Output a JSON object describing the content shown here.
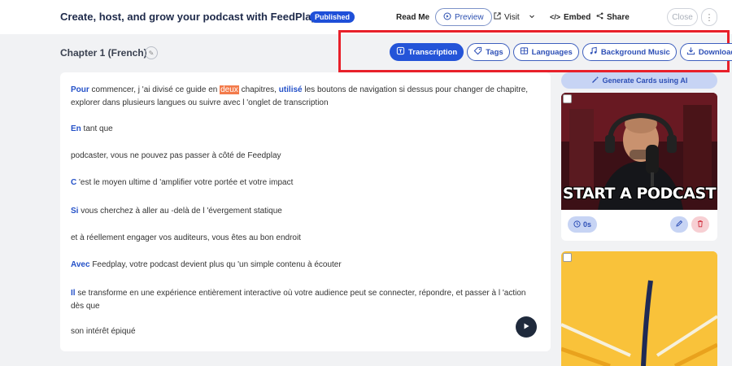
{
  "header": {
    "title": "Create, host, and grow your podcast with FeedPlay!",
    "status_badge": "Published",
    "read_me": "Read Me",
    "preview": "Preview",
    "visit": "Visit",
    "embed": "Embed",
    "share": "Share",
    "close": "Close"
  },
  "chapter": {
    "title": "Chapter 1 (French)"
  },
  "tabs": [
    {
      "label": "Transcription",
      "icon": "transcript-icon",
      "active": true
    },
    {
      "label": "Tags",
      "icon": "tag-icon",
      "active": false
    },
    {
      "label": "Languages",
      "icon": "languages-icon",
      "active": false
    },
    {
      "label": "Background Music",
      "icon": "music-icon",
      "active": false
    },
    {
      "label": "Download",
      "icon": "download-icon",
      "active": false
    }
  ],
  "transcript": {
    "l1": {
      "kw1": "Pour",
      "t1": " commencer, j 'ai divisé ce guide en ",
      "hl": "deux",
      "t2": " chapitres, ",
      "kw2": "utilisé",
      "t3": " les boutons de navigation si dessus pour changer de chapitre,"
    },
    "l1b": "explorer dans plusieurs langues ou suivre avec l 'onglet de transcription",
    "l2": {
      "kw": "En",
      "t": " tant que"
    },
    "l3": "podcaster, vous ne pouvez pas passer à côté de Feedplay",
    "l4": {
      "kw": "C",
      "t": " 'est le moyen ultime d 'amplifier votre portée et votre impact"
    },
    "l5": {
      "kw": "Si",
      "t": " vous cherchez à aller au -delà de l 'évergement statique"
    },
    "l6": "et à réellement engager vos auditeurs, vous êtes au bon endroit",
    "l7": {
      "kw": "Avec",
      "t": " Feedplay, votre podcast devient plus qu 'un simple contenu à écouter"
    },
    "l8": {
      "kw": "Il",
      "t": " se transforme en une expérience entièrement interactive où votre audience peut se connecter, répondre, et passer à l 'action"
    },
    "l8b": "dès que",
    "l9": "son intérêt épiqué"
  },
  "cards": {
    "generate": "Generate Cards using AI",
    "card1": {
      "caption": "START A PODCAST",
      "duration": "0s"
    }
  },
  "colors": {
    "accent": "#2454d8",
    "highlight_box": "#e8202a",
    "word_highlight": "#f37b4b"
  }
}
